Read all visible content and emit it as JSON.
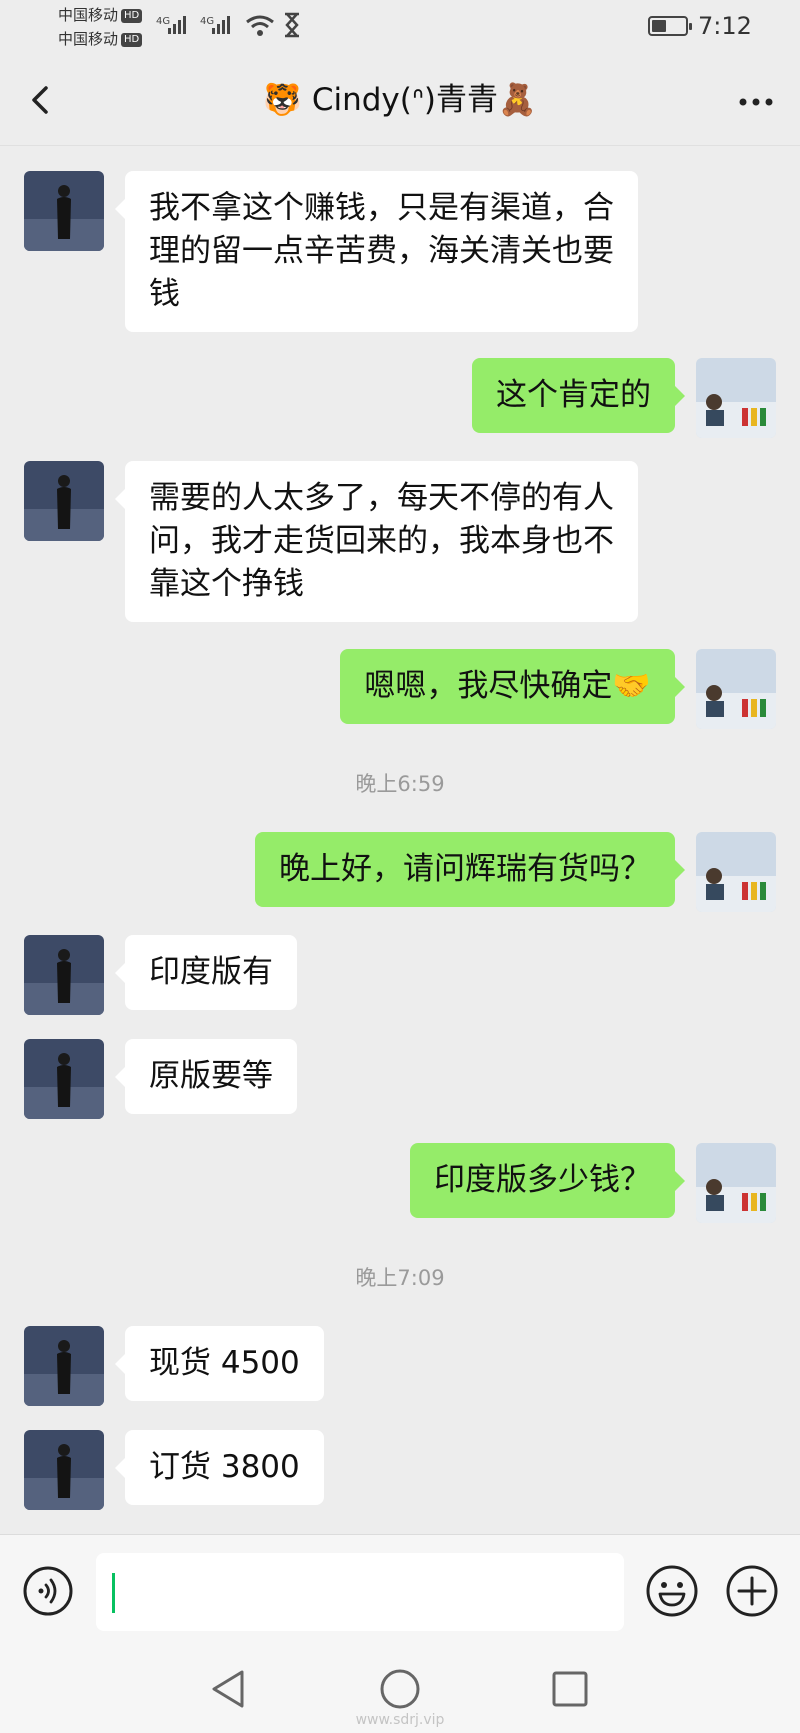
{
  "status_bar": {
    "carrier_1": "中国移动",
    "carrier_2": "中国移动",
    "hd_badge": "HD",
    "network_1": "4G",
    "network_2": "4G",
    "time": "7:12",
    "battery_level": 0.45
  },
  "header": {
    "title": "🐯 Cindy(ᐢ)青青🧸",
    "back_icon": "chevron-left-icon",
    "more_icon": "ellipsis-icon"
  },
  "messages": [
    {
      "side": "in",
      "text": "我不拿这个赚钱，只是有渠道，合\n理的留一点辛苦费，海关清关也要\n钱"
    },
    {
      "side": "out",
      "text": "这个肯定的"
    },
    {
      "side": "in",
      "text": "需要的人太多了，每天不停的有人\n问，我才走货回来的，我本身也不\n靠这个挣钱"
    },
    {
      "side": "out",
      "text": "嗯嗯，我尽快确定🤝"
    },
    {
      "timestamp": "晚上6:59"
    },
    {
      "side": "out",
      "text": "晚上好，请问辉瑞有货吗？"
    },
    {
      "side": "in",
      "text": "印度版有"
    },
    {
      "side": "in",
      "text": "原版要等"
    },
    {
      "side": "out",
      "text": "印度版多少钱？"
    },
    {
      "timestamp": "晚上7:09"
    },
    {
      "side": "in",
      "text": "现货 4500"
    },
    {
      "side": "in",
      "text": "订货 3800"
    }
  ],
  "input_bar": {
    "voice_icon": "voice-icon",
    "input_value": "",
    "emoji_icon": "smiley-icon",
    "plus_icon": "plus-circle-icon"
  },
  "system_nav": {
    "back_icon": "triangle-back-icon",
    "home_icon": "circle-home-icon",
    "recents_icon": "square-recents-icon",
    "watermark": "www.sdrj.vip"
  },
  "colors": {
    "background": "#ededed",
    "outgoing_bubble": "#95ec69",
    "incoming_bubble": "#ffffff",
    "caret": "#07c160"
  }
}
